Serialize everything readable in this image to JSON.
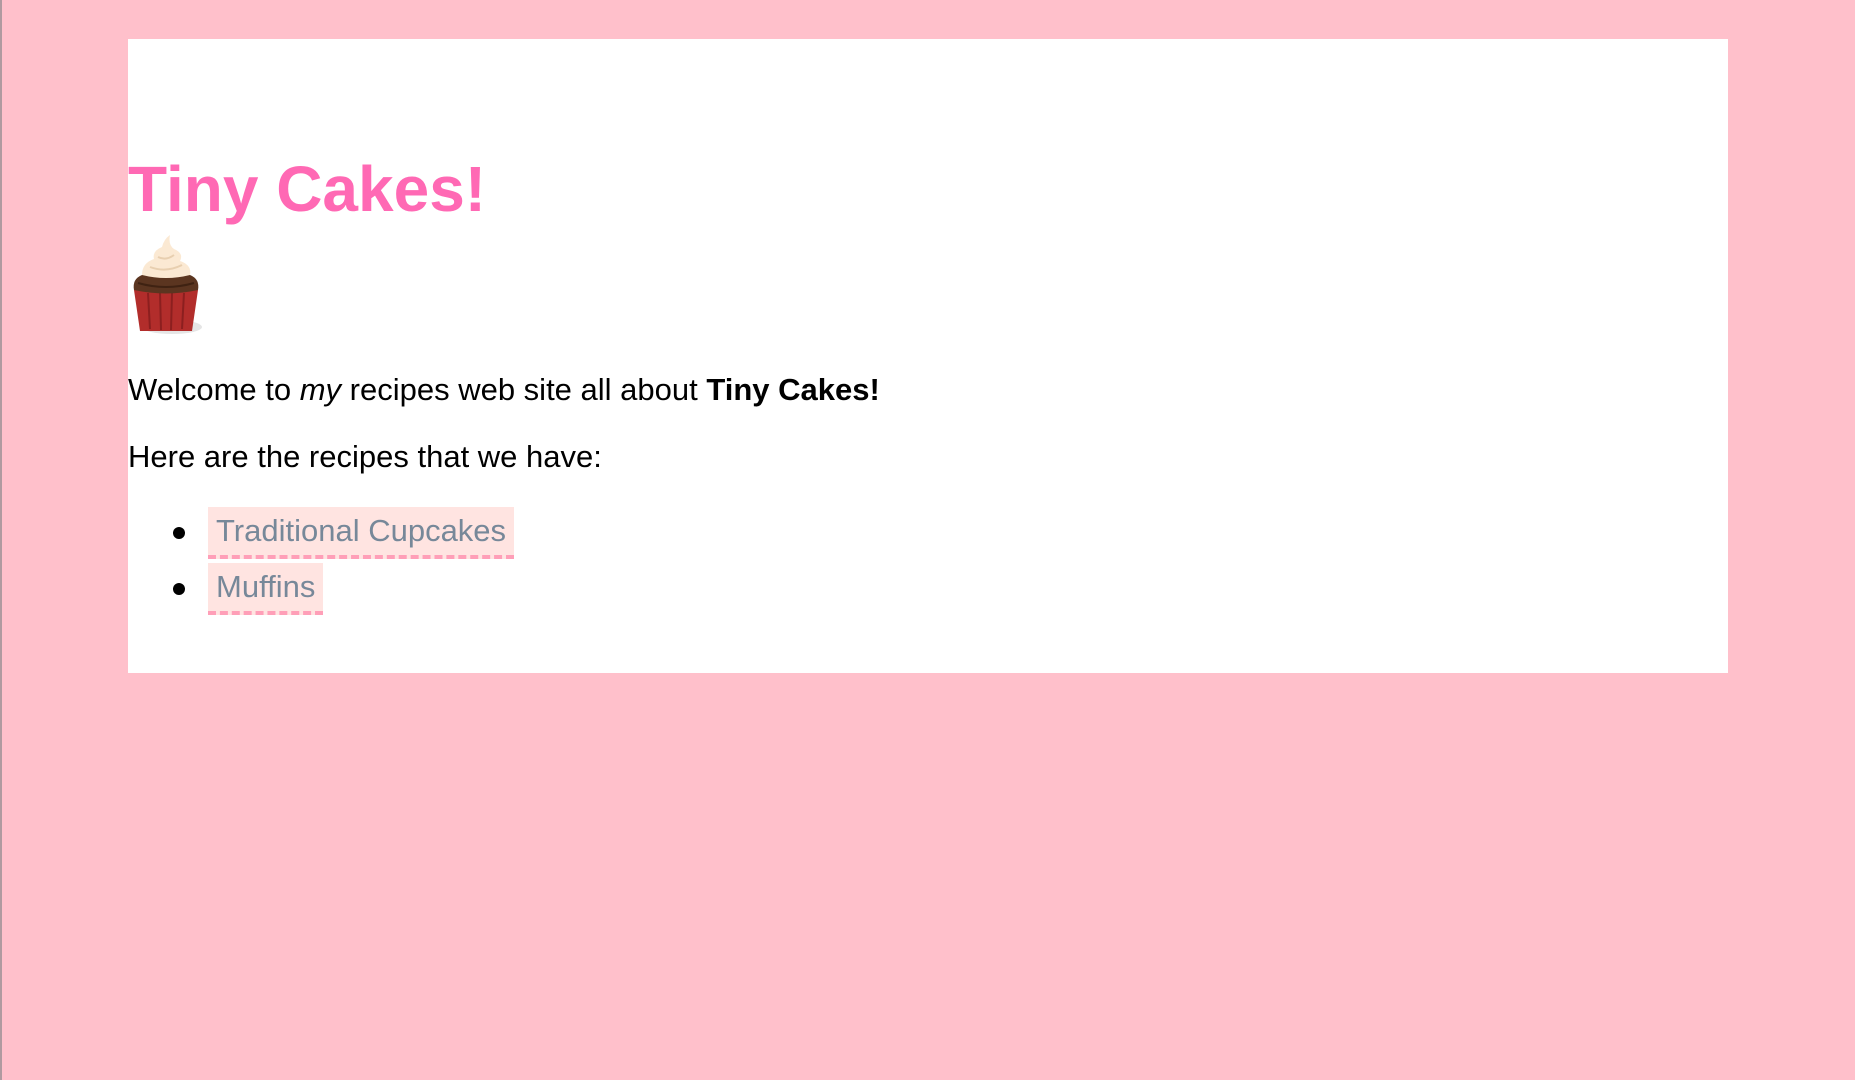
{
  "page": {
    "title": "Tiny Cakes!",
    "background_color": "#ffc0cb",
    "title_color": "#ff69b4",
    "link_color": "#778899",
    "link_background": "#ffe4e1"
  },
  "hero_image": {
    "icon": "cupcake-icon"
  },
  "intro": {
    "part1": "Welcome to ",
    "emphasis": "my",
    "part2": " recipes web site all about ",
    "strong": "Tiny Cakes!"
  },
  "recipes_intro": "Here are the recipes that we have:",
  "recipes": [
    {
      "label": "Traditional Cupcakes"
    },
    {
      "label": "Muffins"
    }
  ]
}
